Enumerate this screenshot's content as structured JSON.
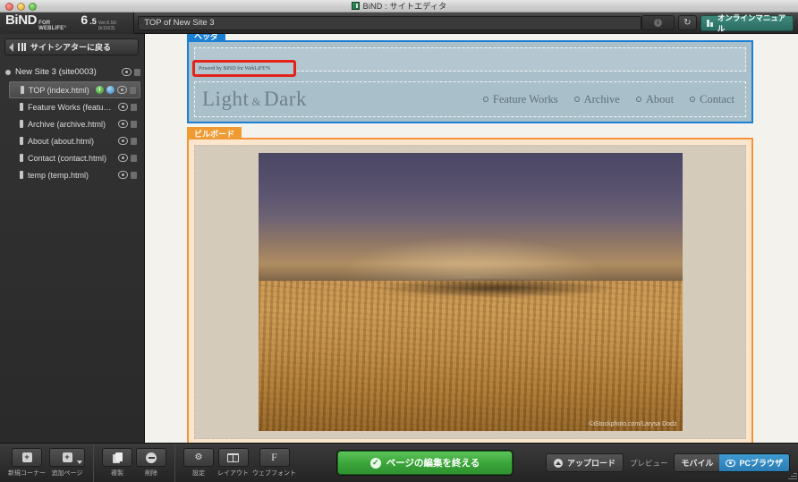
{
  "window": {
    "title": "BiND : サイトエディタ",
    "title_icon": "bind-app-icon"
  },
  "appbar": {
    "brand_name": "BiND",
    "brand_sub": "FOR WEBLIFE°",
    "brand_version_major": "6",
    "brand_version_minor": ".5",
    "brand_build": "Ver.6.50 (b1163)",
    "page_field_value": "TOP of New Site 3",
    "info_label": "i",
    "reload_icon": "↻",
    "manual_label": "オンラインマニュアル"
  },
  "sidebar": {
    "back_label": "サイトシアターに戻る",
    "site_name": "New Site 3 (site0003)",
    "pages": [
      {
        "label": "TOP (index.html)",
        "selected": true
      },
      {
        "label": "Feature Works (feature-work...",
        "selected": false
      },
      {
        "label": "Archive (archive.html)",
        "selected": false
      },
      {
        "label": "About (about.html)",
        "selected": false
      },
      {
        "label": "Contact (contact.html)",
        "selected": false
      },
      {
        "label": "temp (temp.html)",
        "selected": false
      }
    ]
  },
  "canvas": {
    "header_block": {
      "tab_label": "ヘッダ",
      "powered_text": "Powerd by BiND for WebLiFE°6",
      "site_title_left": "Light",
      "site_title_amp": "&",
      "site_title_right": "Dark",
      "nav": [
        "Feature Works",
        "Archive",
        "About",
        "Contact"
      ]
    },
    "billboard_block": {
      "tab_label": "ビルボード",
      "photo_credit": "©iStockphoto.com/Larysa Dodz"
    },
    "pink_block": {
      "tab_label": ""
    }
  },
  "bottombar": {
    "left_tools": [
      {
        "label": "新規コーナー",
        "icon": "plus-box-icon",
        "has_caret": false
      },
      {
        "label": "追加ページ",
        "icon": "plus-box-icon",
        "has_caret": true
      }
    ],
    "mid_tools": [
      {
        "label": "複製",
        "icon": "duplicate-icon"
      },
      {
        "label": "削除",
        "icon": "minus-circle-icon"
      }
    ],
    "right_tools": [
      {
        "label": "設定",
        "icon": "gear-icon"
      },
      {
        "label": "レイアウト",
        "icon": "layout-icon"
      },
      {
        "label": "ウェブフォント",
        "icon": "font-f-icon"
      }
    ],
    "finish_label": "ページの編集を終える",
    "upload_label": "アップロード",
    "preview_label": "プレビュー",
    "segments": [
      {
        "label": "モバイル",
        "active": false
      },
      {
        "label": "PCブラウザ",
        "active": true
      }
    ]
  },
  "colors": {
    "accent_blue": "#1b7fd4",
    "accent_orange": "#f4933c",
    "accent_pink": "#cf63bd",
    "accent_green": "#3ba63a",
    "accent_teal": "#3e8a7c",
    "highlight_red": "#e2231a"
  }
}
